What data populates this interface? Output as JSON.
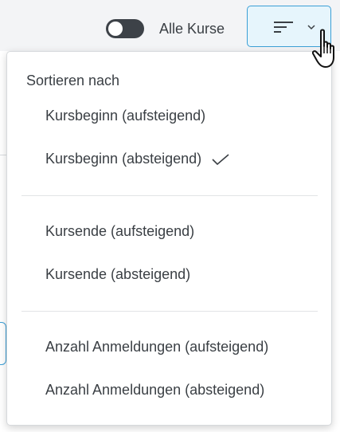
{
  "toolbar": {
    "toggle_label": "Alle Kurse",
    "toggle_on": false,
    "sort_button_icon": "sort-lines-icon",
    "sort_button_chevron": "chevron-down-icon"
  },
  "sort_menu": {
    "header": "Sortieren nach",
    "groups": [
      [
        {
          "label": "Kursbeginn (aufsteigend)",
          "selected": false
        },
        {
          "label": "Kursbeginn (absteigend)",
          "selected": true
        }
      ],
      [
        {
          "label": "Kursende (aufsteigend)",
          "selected": false
        },
        {
          "label": "Kursende (absteigend)",
          "selected": false
        }
      ],
      [
        {
          "label": "Anzahl Anmeldungen (aufsteigend)",
          "selected": false
        },
        {
          "label": "Anzahl Anmeldungen (absteigend)",
          "selected": false
        }
      ]
    ]
  },
  "colors": {
    "accent": "#3a9fd6",
    "accent_bg": "#e6f5fc",
    "text": "#3a3f44"
  }
}
